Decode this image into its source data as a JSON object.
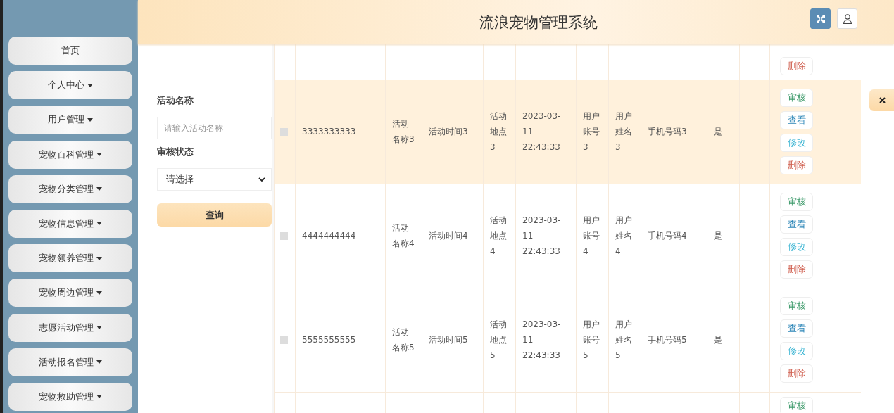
{
  "header": {
    "title": "流浪宠物管理系统"
  },
  "sidebar": {
    "items": [
      {
        "label": "首页",
        "expandable": false
      },
      {
        "label": "个人中心",
        "expandable": true
      },
      {
        "label": "用户管理",
        "expandable": true
      },
      {
        "label": "宠物百科管理",
        "expandable": true
      },
      {
        "label": "宠物分类管理",
        "expandable": true
      },
      {
        "label": "宠物信息管理",
        "expandable": true
      },
      {
        "label": "宠物领养管理",
        "expandable": true
      },
      {
        "label": "宠物周边管理",
        "expandable": true
      },
      {
        "label": "志愿活动管理",
        "expandable": true
      },
      {
        "label": "活动报名管理",
        "expandable": true
      },
      {
        "label": "宠物救助管理",
        "expandable": true
      }
    ]
  },
  "filter": {
    "fields": [
      {
        "kind": "text",
        "label": "活动名称",
        "placeholder": "请输入活动名称"
      },
      {
        "kind": "select",
        "label": "审核状态",
        "value": "请选择"
      }
    ],
    "button": "查询"
  },
  "table": {
    "rows": [
      {
        "kind": "cut-top",
        "highlighted": false,
        "actions": [
          {
            "label": "删除",
            "kind": "delete"
          }
        ]
      },
      {
        "kind": "full",
        "highlighted": true,
        "checked": false,
        "cells": [
          "3333333333",
          "活动名称3",
          "活动时间3",
          "活动地点3",
          "2023-03-11 22:43:33",
          "用户账号3",
          "用户姓名3",
          "手机号码3",
          "是"
        ],
        "actions": [
          {
            "label": "审核",
            "kind": "audit"
          },
          {
            "label": "查看",
            "kind": "view"
          },
          {
            "label": "修改",
            "kind": "edit"
          },
          {
            "label": "删除",
            "kind": "delete"
          }
        ]
      },
      {
        "kind": "full",
        "highlighted": false,
        "checked": false,
        "cells": [
          "4444444444",
          "活动名称4",
          "活动时间4",
          "活动地点4",
          "2023-03-11 22:43:33",
          "用户账号4",
          "用户姓名4",
          "手机号码4",
          "是"
        ],
        "actions": [
          {
            "label": "审核",
            "kind": "audit"
          },
          {
            "label": "查看",
            "kind": "view"
          },
          {
            "label": "修改",
            "kind": "edit"
          },
          {
            "label": "删除",
            "kind": "delete"
          }
        ]
      },
      {
        "kind": "full",
        "highlighted": false,
        "checked": false,
        "cells": [
          "5555555555",
          "活动名称5",
          "活动时间5",
          "活动地点5",
          "2023-03-11 22:43:33",
          "用户账号5",
          "用户姓名5",
          "手机号码5",
          "是"
        ],
        "actions": [
          {
            "label": "审核",
            "kind": "audit"
          },
          {
            "label": "查看",
            "kind": "view"
          },
          {
            "label": "修改",
            "kind": "edit"
          },
          {
            "label": "删除",
            "kind": "delete"
          }
        ]
      },
      {
        "kind": "cut-bottom",
        "highlighted": false,
        "actions": [
          {
            "label": "审核",
            "kind": "audit"
          }
        ]
      }
    ]
  }
}
